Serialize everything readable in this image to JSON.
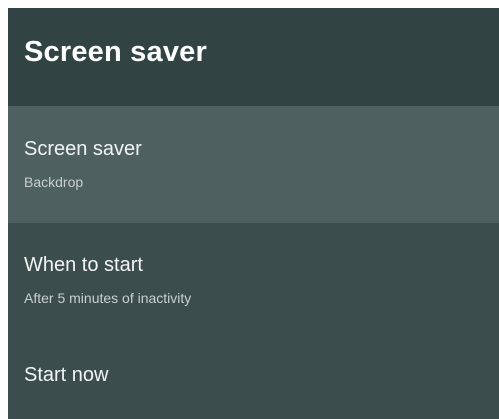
{
  "header": {
    "title": "Screen saver"
  },
  "settings": {
    "items": [
      {
        "title": "Screen saver",
        "summary": "Backdrop"
      },
      {
        "title": "When to start",
        "summary": "After 5 minutes of inactivity"
      },
      {
        "title": "Start now"
      }
    ]
  },
  "colors": {
    "header_bg": "#314343",
    "list_bg": "#3c4d4d",
    "focused_bg": "#4e6060",
    "title_text": "#f2f4f4",
    "summary_text": "#c8d0d0"
  }
}
